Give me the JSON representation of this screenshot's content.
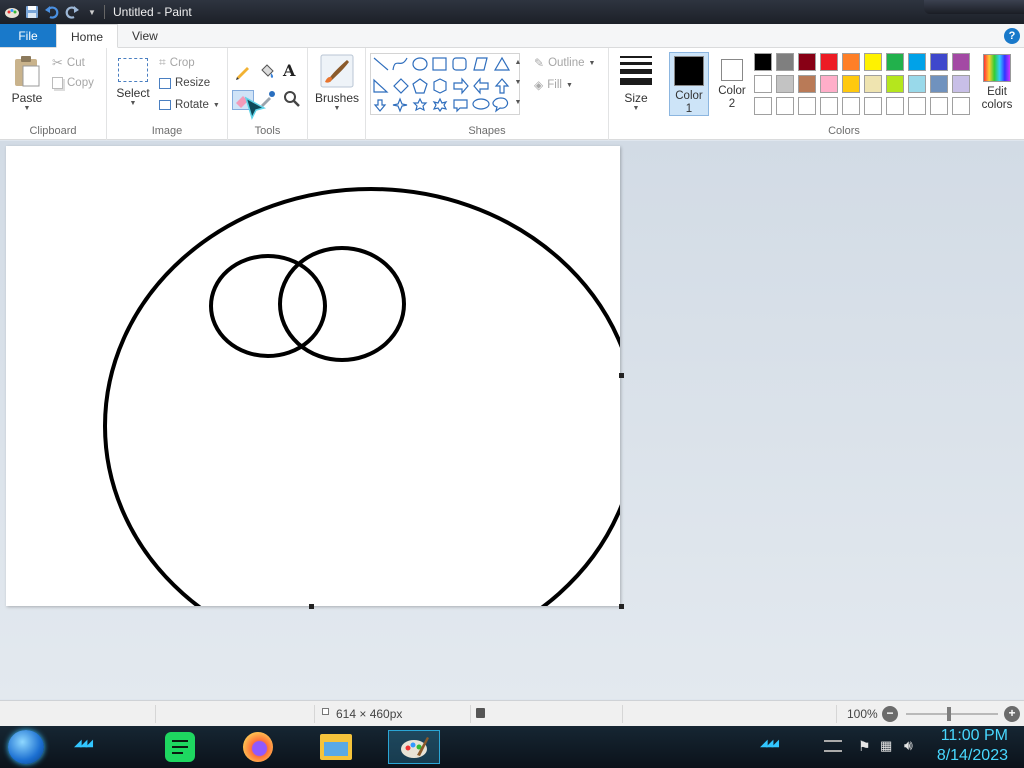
{
  "window": {
    "title": "Untitled - Paint"
  },
  "tabs": {
    "file": "File",
    "home": "Home",
    "view": "View",
    "help": "?"
  },
  "clipboard": {
    "paste": "Paste",
    "cut": "Cut",
    "copy": "Copy",
    "label": "Clipboard"
  },
  "image": {
    "select": "Select",
    "crop": "Crop",
    "resize": "Resize",
    "rotate": "Rotate",
    "label": "Image"
  },
  "tools": {
    "label": "Tools",
    "text_glyph": "A"
  },
  "brushes": {
    "label": "Brushes"
  },
  "shapes": {
    "outline": "Outline",
    "fill": "Fill",
    "label": "Shapes"
  },
  "size": {
    "label": "Size"
  },
  "colors": {
    "color1_label": "Color\n1",
    "color2_label": "Color\n2",
    "edit_label": "Edit\ncolors",
    "label": "Colors",
    "color1": "#000000",
    "color2": "#ffffff",
    "palette_row1": [
      "#000000",
      "#7f7f7f",
      "#880015",
      "#ed1c24",
      "#ff7f27",
      "#fff200",
      "#22b14c",
      "#00a2e8",
      "#3f48cc",
      "#a349a4"
    ],
    "palette_row2": [
      "#ffffff",
      "#c3c3c3",
      "#b97a57",
      "#ffaec9",
      "#ffc90e",
      "#efe4b0",
      "#b5e61d",
      "#99d9ea",
      "#7092be",
      "#c8bfe7"
    ],
    "palette_row3": [
      "#ffffff",
      "#ffffff",
      "#ffffff",
      "#ffffff",
      "#ffffff",
      "#ffffff",
      "#ffffff",
      "#ffffff",
      "#ffffff",
      "#ffffff"
    ]
  },
  "status": {
    "canvas_size": "614 × 460px",
    "zoom": "100%"
  },
  "taskbar": {
    "time": "11:00 PM",
    "date": "8/14/2023"
  }
}
